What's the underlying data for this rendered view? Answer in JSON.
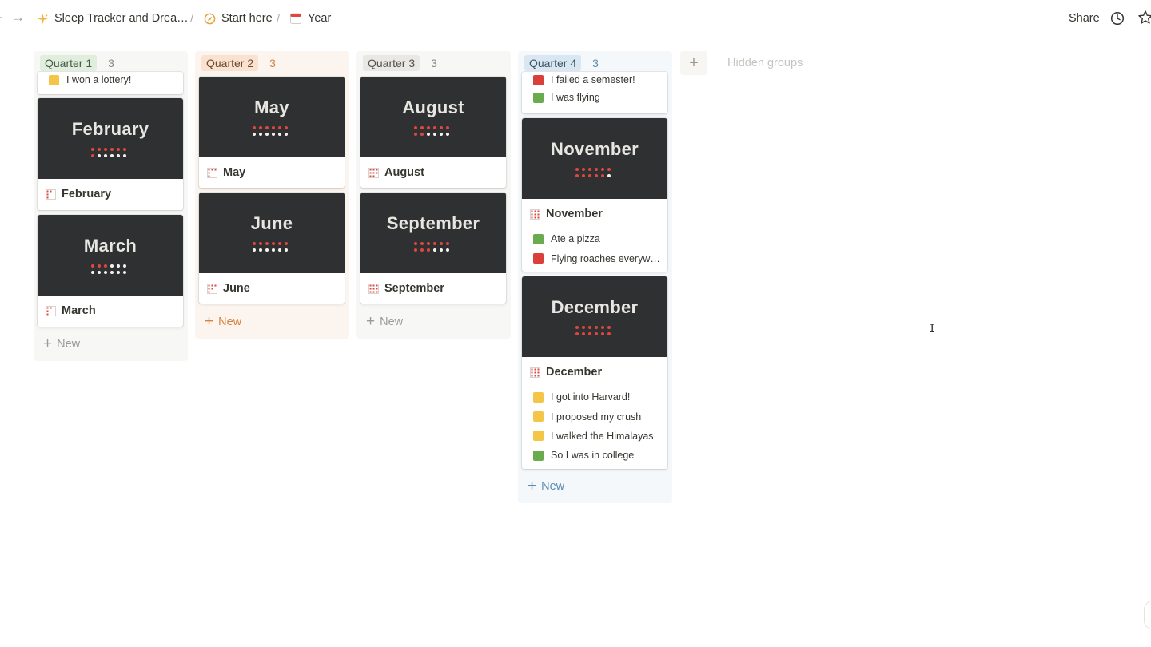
{
  "breadcrumb": {
    "items": [
      {
        "label": "Sleep Tracker and Drea…",
        "icon": "sparkles-icon"
      },
      {
        "label": "Start here",
        "icon": "compass-icon"
      },
      {
        "label": "Year",
        "icon": "calendar-icon"
      }
    ],
    "separator": "/"
  },
  "topbar": {
    "share_label": "Share"
  },
  "board": {
    "groups": [
      {
        "label": "Quarter 1",
        "count": "3",
        "tag_bg": "#dfeedd",
        "tag_color": "#4b5a47",
        "col_bg": "#f7f7f5",
        "cards": [
          {
            "partial_prop": "I won a lottery!",
            "partial_color": "#f5c547"
          },
          {
            "cover": "February",
            "title": "February"
          },
          {
            "cover": "March",
            "title": "March"
          }
        ],
        "new_label": "New"
      },
      {
        "label": "Quarter 2",
        "count": "3",
        "tag_bg": "#fbe1cf",
        "tag_color": "#6b4a33",
        "col_bg": "#fcf5ef",
        "cards": [
          {
            "cover": "May",
            "title": "May"
          },
          {
            "cover": "June",
            "title": "June"
          }
        ],
        "new_label": "New"
      },
      {
        "label": "Quarter 3",
        "count": "3",
        "tag_bg": "#e9e8e5",
        "tag_color": "#55534e",
        "col_bg": "#f7f7f6",
        "cards": [
          {
            "cover": "August",
            "title": "August"
          },
          {
            "cover": "September",
            "title": "September"
          }
        ],
        "new_label": "New"
      },
      {
        "label": "Quarter 4",
        "count": "3",
        "tag_bg": "#d8e7f1",
        "tag_color": "#3f5666",
        "col_bg": "#f5f8fa",
        "cards": [
          {
            "partial_props": [
              {
                "text": "I failed a semester!",
                "color": "#d9403a"
              },
              {
                "text": "I was flying",
                "color": "#6aab4f"
              }
            ]
          },
          {
            "cover": "November",
            "title": "November",
            "props": [
              {
                "text": "Ate a pizza",
                "color": "#6aab4f"
              },
              {
                "text": "Flying roaches everyw…",
                "color": "#d9403a"
              }
            ]
          },
          {
            "cover": "December",
            "title": "December",
            "props": [
              {
                "text": "I got into Harvard!",
                "color": "#f5c547"
              },
              {
                "text": "I proposed my crush",
                "color": "#f5c547"
              },
              {
                "text": "I walked the Himalayas",
                "color": "#f5c547"
              },
              {
                "text": "So I was in college",
                "color": "#6aab4f"
              }
            ]
          }
        ],
        "new_label": "New"
      }
    ],
    "hidden_groups_label": "Hidden groups",
    "new_text_colors": {
      "q1": "#9b9a97",
      "q2": "#d9823f",
      "q3": "#9b9a97",
      "q4": "#5d8bb0"
    }
  },
  "colors": {
    "cover_bg": "#2f3032",
    "dot_red": "#e0463d",
    "dot_white": "#f4f2ee"
  }
}
